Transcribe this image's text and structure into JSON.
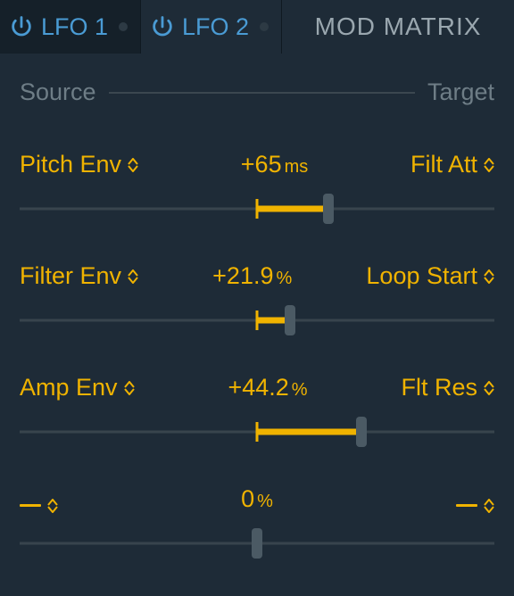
{
  "tabs": {
    "lfo1": "LFO 1",
    "lfo2": "LFO 2",
    "modmatrix": "MOD MATRIX"
  },
  "header": {
    "source": "Source",
    "target": "Target"
  },
  "rows": [
    {
      "source": "Pitch Env",
      "valueText": "+65",
      "unit": "ms",
      "target": "Filt Att",
      "emptySource": false,
      "emptyTarget": false,
      "fillStart": 50,
      "fillEnd": 65,
      "thumb": 65
    },
    {
      "source": "Filter Env",
      "valueText": "+21.9",
      "unit": "%",
      "target": "Loop Start",
      "emptySource": false,
      "emptyTarget": false,
      "fillStart": 50,
      "fillEnd": 57,
      "thumb": 57
    },
    {
      "source": "Amp Env",
      "valueText": "+44.2",
      "unit": "%",
      "target": "Flt Res",
      "emptySource": false,
      "emptyTarget": false,
      "fillStart": 50,
      "fillEnd": 72,
      "thumb": 72
    },
    {
      "source": "",
      "valueText": "0",
      "unit": "%",
      "target": "",
      "emptySource": true,
      "emptyTarget": true,
      "fillStart": 50,
      "fillEnd": 50,
      "thumb": 50
    }
  ]
}
